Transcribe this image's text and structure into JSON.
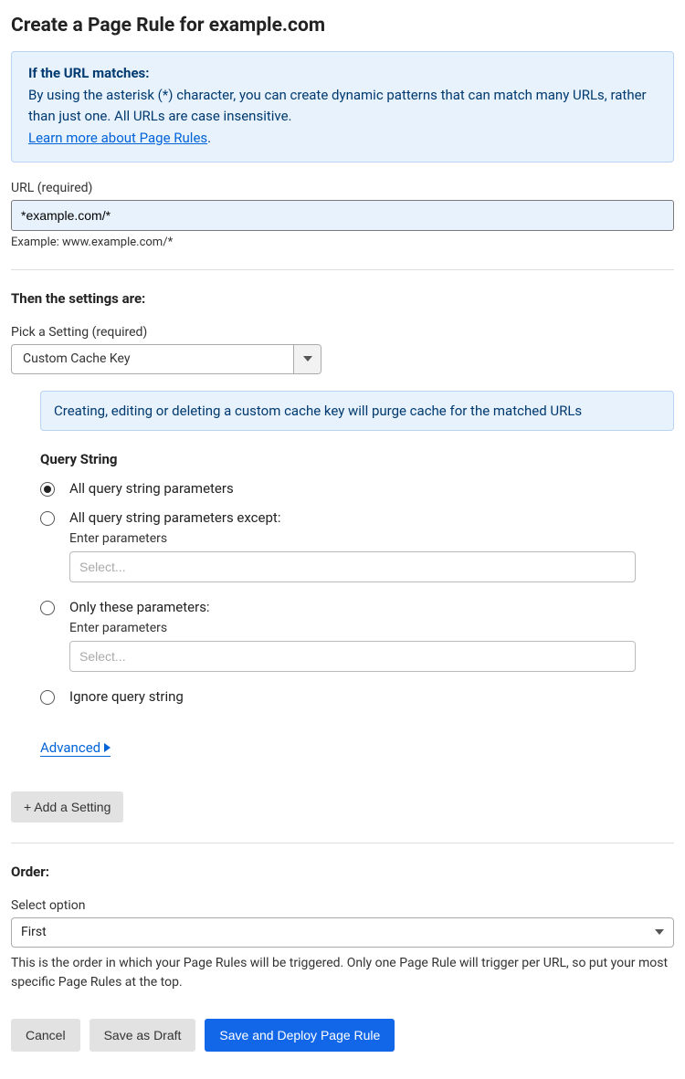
{
  "page_title": "Create a Page Rule for example.com",
  "info": {
    "title": "If the URL matches:",
    "body": "By using the asterisk (*) character, you can create dynamic patterns that can match many URLs, rather than just one. All URLs are case insensitive.",
    "link_text": "Learn more about Page Rules",
    "link_suffix": "."
  },
  "url_field": {
    "label": "URL (required)",
    "value": "*example.com/*",
    "example": "Example: www.example.com/*"
  },
  "settings_heading": "Then the settings are:",
  "setting_select": {
    "label": "Pick a Setting (required)",
    "value": "Custom Cache Key"
  },
  "cache_notice": "Creating, editing or deleting a custom cache key will purge cache for the matched URLs",
  "query_string": {
    "heading": "Query String",
    "options": [
      {
        "label": "All query string parameters",
        "selected": true
      },
      {
        "label": "All query string parameters except:",
        "selected": false,
        "subfield_label": "Enter parameters",
        "placeholder": "Select..."
      },
      {
        "label": "Only these parameters:",
        "selected": false,
        "subfield_label": "Enter parameters",
        "placeholder": "Select..."
      },
      {
        "label": "Ignore query string",
        "selected": false
      }
    ]
  },
  "advanced_label": "Advanced",
  "add_setting_label": "+ Add a Setting",
  "order": {
    "heading": "Order:",
    "label": "Select option",
    "value": "First",
    "helper": "This is the order in which your Page Rules will be triggered. Only one Page Rule will trigger per URL, so put your most specific Page Rules at the top."
  },
  "buttons": {
    "cancel": "Cancel",
    "save_draft": "Save as Draft",
    "save_deploy": "Save and Deploy Page Rule"
  }
}
